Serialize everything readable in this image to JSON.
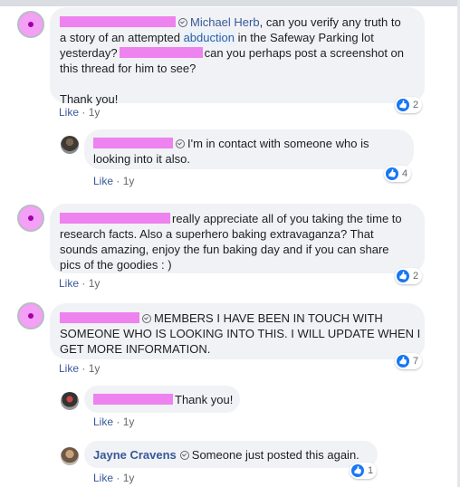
{
  "comments": [
    {
      "id": "c1",
      "lines": [
        {
          "mention": "Michael Herb",
          "text": ", can you verify any truth to"
        },
        {
          "pre": "a story of an attempted ",
          "highlight": "abduction",
          "post": " in the Safeway Parking lot"
        },
        {
          "pre": "yesterday?",
          "post": "can you perhaps post a screenshot on"
        },
        {
          "text": "this thread for him to see?"
        },
        {
          "text": ""
        },
        {
          "text": "Thank you!"
        }
      ],
      "like": "Like",
      "time": "1y",
      "reactions": "2"
    },
    {
      "id": "r1",
      "lines": [
        {
          "post": "I'm in contact with someone who is"
        },
        {
          "text": "looking into it also."
        }
      ],
      "like": "Like",
      "time": "1y",
      "reactions": "4"
    },
    {
      "id": "c2",
      "lines": [
        {
          "post": "really appreciate all of you taking the time to"
        },
        {
          "text": "research facts. Also a superhero baking extravaganza? That"
        },
        {
          "text": "sounds amazing, enjoy the fun baking day and if you can share"
        },
        {
          "text": "pics of the goodies : )"
        }
      ],
      "like": "Like",
      "time": "1y",
      "reactions": "2"
    },
    {
      "id": "c3",
      "lines": [
        {
          "post": "MEMBERS I HAVE BEEN IN TOUCH WITH"
        },
        {
          "text": "SOMEONE WHO IS LOOKING INTO THIS. I WILL UPDATE WHEN I"
        },
        {
          "text": "GET MORE INFORMATION."
        }
      ],
      "like": "Like",
      "time": "1y",
      "reactions": "7"
    },
    {
      "id": "r2",
      "lines": [
        {
          "post": "Thank you!"
        }
      ],
      "like": "Like",
      "time": "1y"
    },
    {
      "id": "r3",
      "author": "Jayne Cravens",
      "lines": [
        {
          "post": "Someone just posted this again."
        }
      ],
      "like": "Like",
      "time": "1y",
      "reactions": "1"
    }
  ],
  "separator": " · ",
  "colors": {
    "redaction": "#ee82ee",
    "link": "#385898",
    "bubble": "#f0f2f5",
    "like_icon": "#1877f2"
  },
  "icons": {
    "verified": "verified-badge-icon",
    "reaction": "thumbs-up-icon"
  }
}
